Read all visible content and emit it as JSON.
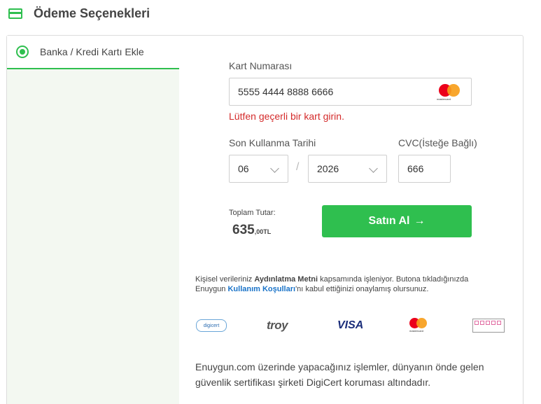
{
  "header": {
    "title": "Ödeme Seçenekleri",
    "icon": "credit-card-icon"
  },
  "tab": {
    "label": "Banka / Kredi Kartı Ekle"
  },
  "card": {
    "number_label": "Kart Numarası",
    "number_value": "5555 4444 8888 6666",
    "brand_text": "mastercard",
    "error": "Lütfen geçerli bir kart girin."
  },
  "expiry": {
    "label": "Son Kullanma Tarihi",
    "month": "06",
    "separator": "/",
    "year": "2026"
  },
  "cvc": {
    "label": "CVC(İsteğe Bağlı)",
    "value": "666"
  },
  "total": {
    "label": "Toplam Tutar:",
    "amount_main": "635",
    "amount_decimal": ",00TL"
  },
  "buy_button": {
    "label": "Satın Al",
    "arrow": "→"
  },
  "legal": {
    "p1": "Kişisel verileriniz ",
    "link1": "Aydınlatma Metni",
    "p2": " kapsamında işleniyor. Butona tıkladığınızda Enuygun ",
    "link2": "Kullanım Koşulları",
    "p3": "'nı kabul ettiğinizi onaylamış olursunuz."
  },
  "logos": {
    "digicert": "digicert",
    "troy": "troy",
    "visa": "VISA",
    "mastercard": "mastercard"
  },
  "footer": "Enuygun.com üzerinde yapacağınız işlemler, dünyanın önde gelen güvenlik sertifikası şirketi DigiCert koruması altındadır.",
  "colors": {
    "accent": "#2fbf4f",
    "error": "#d42b2b",
    "link": "#1a73c8"
  }
}
